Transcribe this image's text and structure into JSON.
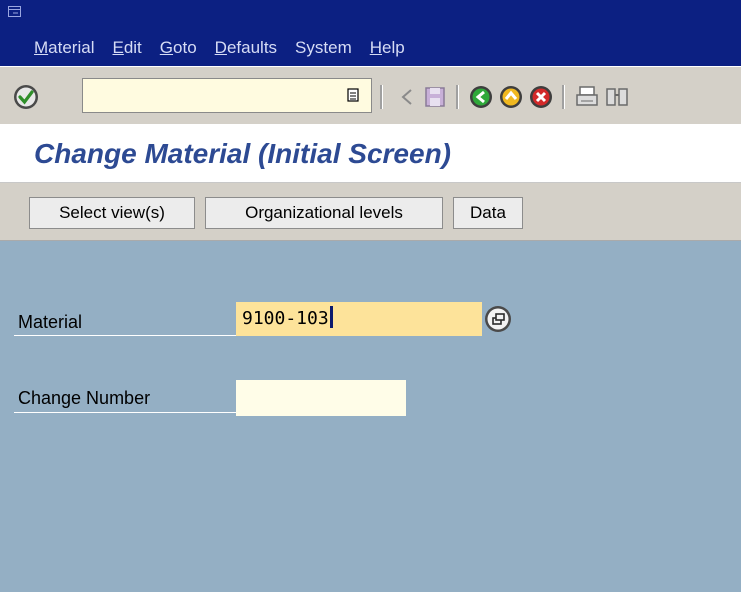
{
  "menu": {
    "items": [
      {
        "key": "M",
        "rest": "aterial"
      },
      {
        "key": "E",
        "rest": "dit"
      },
      {
        "key": "G",
        "rest": "oto"
      },
      {
        "key": "D",
        "rest": "efaults"
      },
      {
        "key": "",
        "rest": "System"
      },
      {
        "key": "H",
        "rest": "elp"
      }
    ]
  },
  "toolbar": {
    "command_field_value": "",
    "icons": [
      "enter-icon",
      "command-dropdown-icon",
      "back-arrow-icon",
      "save-icon",
      "back-icon",
      "exit-icon",
      "cancel-icon",
      "print-icon",
      "find-icon"
    ]
  },
  "title": "Change Material (Initial Screen)",
  "app_toolbar": {
    "select_views": "Select view(s)",
    "org_levels": "Organizational levels",
    "data": "Data"
  },
  "form": {
    "material_label": "Material",
    "material_value": "9100-103",
    "change_number_label": "Change Number",
    "change_number_value": ""
  },
  "colors": {
    "menubar": "#0c2082",
    "workarea": "#94afc4",
    "title": "#2d4a93",
    "active_field": "#fde39a"
  }
}
